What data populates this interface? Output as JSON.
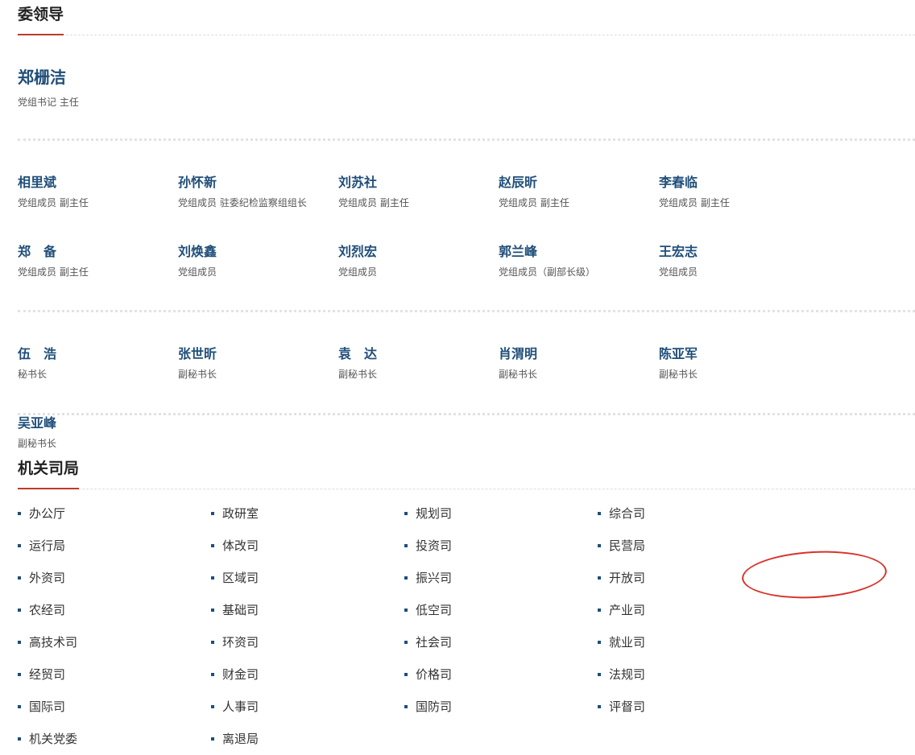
{
  "leadership": {
    "title": "委领导",
    "head": {
      "name": "郑栅洁",
      "role": "党组书记 主任"
    },
    "members": [
      {
        "name": "相里斌",
        "role": "党组成员 副主任"
      },
      {
        "name": "孙怀新",
        "role": "党组成员 驻委纪检监察组组长"
      },
      {
        "name": "刘苏社",
        "role": "党组成员 副主任"
      },
      {
        "name": "赵辰昕",
        "role": "党组成员 副主任"
      },
      {
        "name": "李春临",
        "role": "党组成员 副主任"
      },
      {
        "name": "郑　备",
        "role": "党组成员 副主任"
      },
      {
        "name": "刘焕鑫",
        "role": "党组成员"
      },
      {
        "name": "刘烈宏",
        "role": "党组成员"
      },
      {
        "name": "郭兰峰",
        "role": "党组成员（副部长级）"
      },
      {
        "name": "王宏志",
        "role": "党组成员"
      }
    ],
    "secretaries": [
      {
        "name": "伍　浩",
        "role": "秘书长"
      },
      {
        "name": "张世昕",
        "role": "副秘书长"
      },
      {
        "name": "袁　达",
        "role": "副秘书长"
      },
      {
        "name": "肖渭明",
        "role": "副秘书长"
      },
      {
        "name": "陈亚军",
        "role": "副秘书长"
      },
      {
        "name": "吴亚峰",
        "role": "副秘书长"
      }
    ]
  },
  "departments": {
    "title": "机关司局",
    "items": [
      "办公厅",
      "政研室",
      "规划司",
      "综合司",
      "运行局",
      "体改司",
      "投资司",
      "民营局",
      "外资司",
      "区域司",
      "振兴司",
      "开放司",
      "农经司",
      "基础司",
      "低空司",
      "产业司",
      "高技术司",
      "环资司",
      "社会司",
      "就业司",
      "经贸司",
      "财金司",
      "价格司",
      "法规司",
      "国际司",
      "人事司",
      "国防司",
      "评督司",
      "机关党委",
      "离退局"
    ],
    "highlighted": "低空司",
    "highlight_color": "#d9322a",
    "accent_color": "#c0392b",
    "name_color": "#1f4e79"
  }
}
